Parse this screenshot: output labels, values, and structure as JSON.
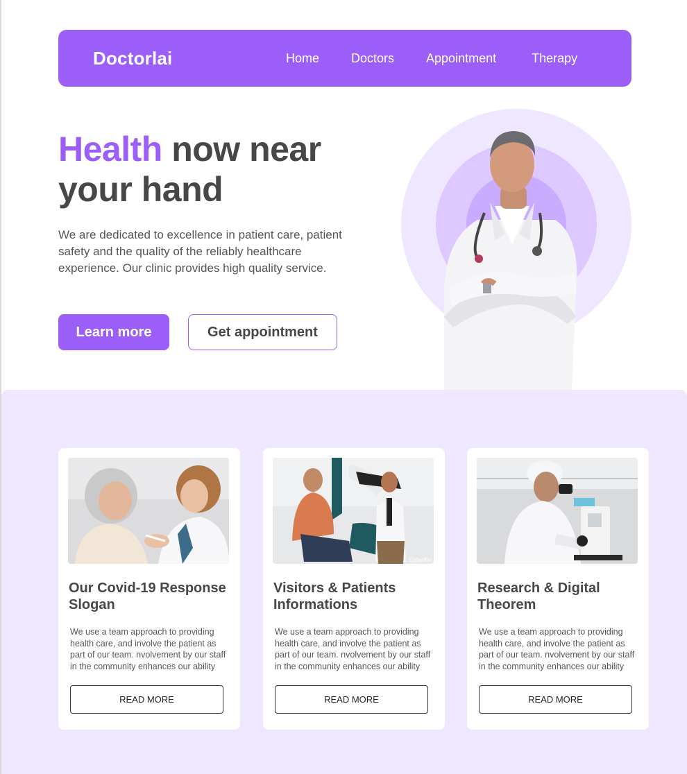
{
  "nav": {
    "brand": "Doctorlai",
    "links": [
      "Home",
      "Doctors",
      "Appointment",
      "Therapy"
    ]
  },
  "hero": {
    "title_accent": "Health",
    "title_rest": " now near your hand",
    "description": "We are dedicated to excellence in patient care, patient safety and the quality of the reliably healthcare experience. Our clinic provides high quality service.",
    "primary_button": "Learn more",
    "secondary_button": "Get appointment",
    "image_icon": "doctor-portrait-icon"
  },
  "cards": [
    {
      "title": "Our Covid-19 Response Slogan",
      "text": "We use a team approach to providing health care, and involve the patient as part of our team. nvolvement by our staff in the community enhances our ability",
      "button": "READ MORE",
      "image_icon": "vaccination-photo-icon"
    },
    {
      "title": "Visitors & Patients Informations",
      "text": "We use a team approach to providing health care, and involve the patient as part of our team. nvolvement by our staff in the community enhances our ability",
      "button": "READ MORE",
      "image_icon": "patient-consultation-photo-icon",
      "watermark": "CyberKni"
    },
    {
      "title": "Research & Digital Theorem",
      "text": "We use a team approach to providing health care, and involve the patient as part of our team. nvolvement by our staff in the community enhances our ability",
      "button": "READ MORE",
      "image_icon": "microscope-research-photo-icon"
    }
  ],
  "colors": {
    "accent": "#9b5ef8",
    "lavender_bg": "#eee7ff",
    "text_dark": "#474747"
  }
}
